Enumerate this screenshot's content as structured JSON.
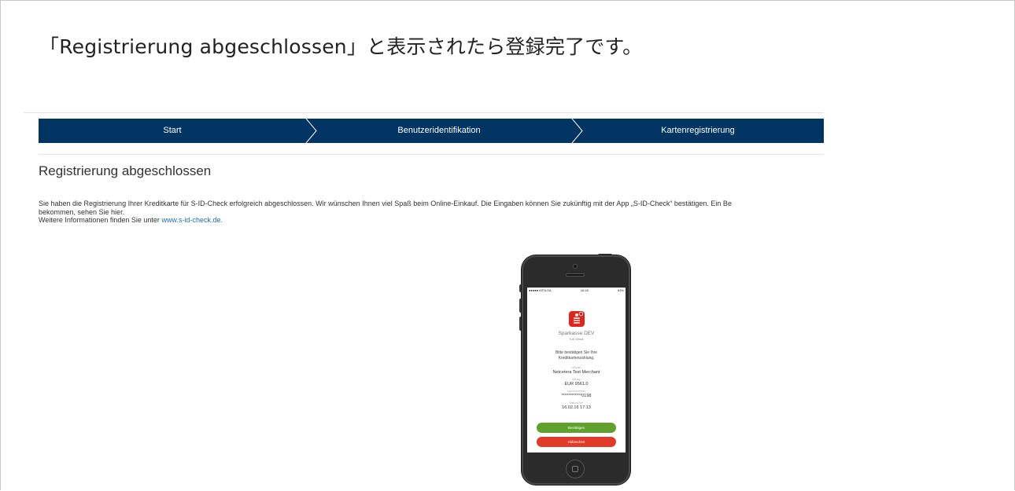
{
  "caption": "「Registrierung abgeschlossen」と表示されたら登録完了です。",
  "steps": [
    {
      "label": "Start"
    },
    {
      "label": "Benutzeridentifikation"
    },
    {
      "label": "Kartenregistrierung"
    }
  ],
  "colors": {
    "stepbar": "#003463",
    "link": "#1a6fb5",
    "confirm": "#5fa12c",
    "cancel": "#e03a2a",
    "logo": "#e3241b"
  },
  "page": {
    "heading": "Registrierung abgeschlossen",
    "body_line1": "Sie haben die Registrierung Ihrer Kreditkarte für S-ID-Check erfolgreich abgeschlossen. Wir wünschen Ihnen viel Spaß beim Online-Einkauf. Die Eingaben können Sie zukünftig mit der App „S-ID-Check“ bestätigen. Ein Be",
    "body_line2": "bekommen, sehen Sie hier.",
    "info_prefix": "Weitere Informationen finden Sie unter ",
    "info_link": "www.s-id-check.de."
  },
  "phone": {
    "status_carrier": "●●●●● MTN-SA",
    "status_time": "16:18",
    "status_right": "63%",
    "bank_name": "Sparkasse DEV",
    "app_name": "S-ID-Check",
    "prompt_line1": "Bitte bestätigen Sie Ihre",
    "prompt_line2": "Kreditkartenzahlung.",
    "merchant_label": "Händler",
    "merchant_value": "Netcetera Test Merchant",
    "amount_label": "Betrag",
    "amount_value": "EUR 9561.0",
    "card_label": "Kartennummer",
    "card_value": "************0198",
    "date_label": "Datum/Zeit",
    "date_value": "16.02.16 17:13",
    "confirm_label": "Bestätigen",
    "cancel_label": "Abbrechen"
  }
}
